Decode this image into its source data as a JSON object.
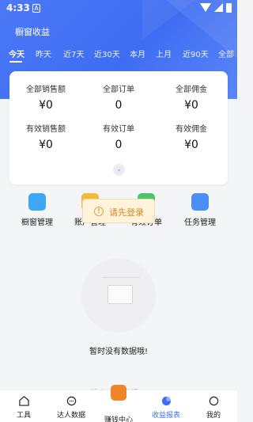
{
  "status_bar": {
    "time": "4:33",
    "sim_label": "A"
  },
  "header": {
    "title": "橱窗收益"
  },
  "tabs": [
    {
      "label": "今天",
      "active": true
    },
    {
      "label": "昨天"
    },
    {
      "label": "近7天"
    },
    {
      "label": "近30天"
    },
    {
      "label": "本月"
    },
    {
      "label": "上月"
    },
    {
      "label": "近90天"
    },
    {
      "label": "全部"
    }
  ],
  "stats": {
    "total_sales_label": "全部销售额",
    "total_sales_value": "¥0",
    "total_orders_label": "全部订单",
    "total_orders_value": "0",
    "total_commission_label": "全部佣金",
    "total_commission_value": "¥0",
    "valid_sales_label": "有效销售额",
    "valid_sales_value": "¥0",
    "valid_orders_label": "有效订单",
    "valid_orders_value": "0",
    "valid_commission_label": "有效佣金",
    "valid_commission_value": "¥0"
  },
  "menu": [
    {
      "label": "橱窗管理",
      "icon": "shop-bag-icon",
      "color": "#3ea7f5"
    },
    {
      "label": "账户管理",
      "icon": "wallet-icon",
      "color": "#f5b83a"
    },
    {
      "label": "有效订单",
      "icon": "order-icon",
      "color": "#4cc66b"
    },
    {
      "label": "任务管理",
      "icon": "task-list-icon",
      "color": "#4b8ff6"
    }
  ],
  "toast": {
    "text": "请先登录"
  },
  "empty_state": {
    "text": "暂时没有数据哦!"
  },
  "footer_hint": {
    "text": "—没有更多数据了—"
  },
  "bottom_nav": [
    {
      "label": "工具",
      "icon": "home-icon"
    },
    {
      "label": "达人数据",
      "icon": "chat-icon"
    },
    {
      "label": "赚钱中心",
      "icon": "money-bag-icon"
    },
    {
      "label": "收益报表",
      "icon": "pie-chart-icon",
      "active": true
    },
    {
      "label": "我的",
      "icon": "user-icon"
    }
  ],
  "colors": {
    "primary": "#3f6df2",
    "accent_orange": "#f0862b",
    "toast_text": "#d48a1e"
  }
}
